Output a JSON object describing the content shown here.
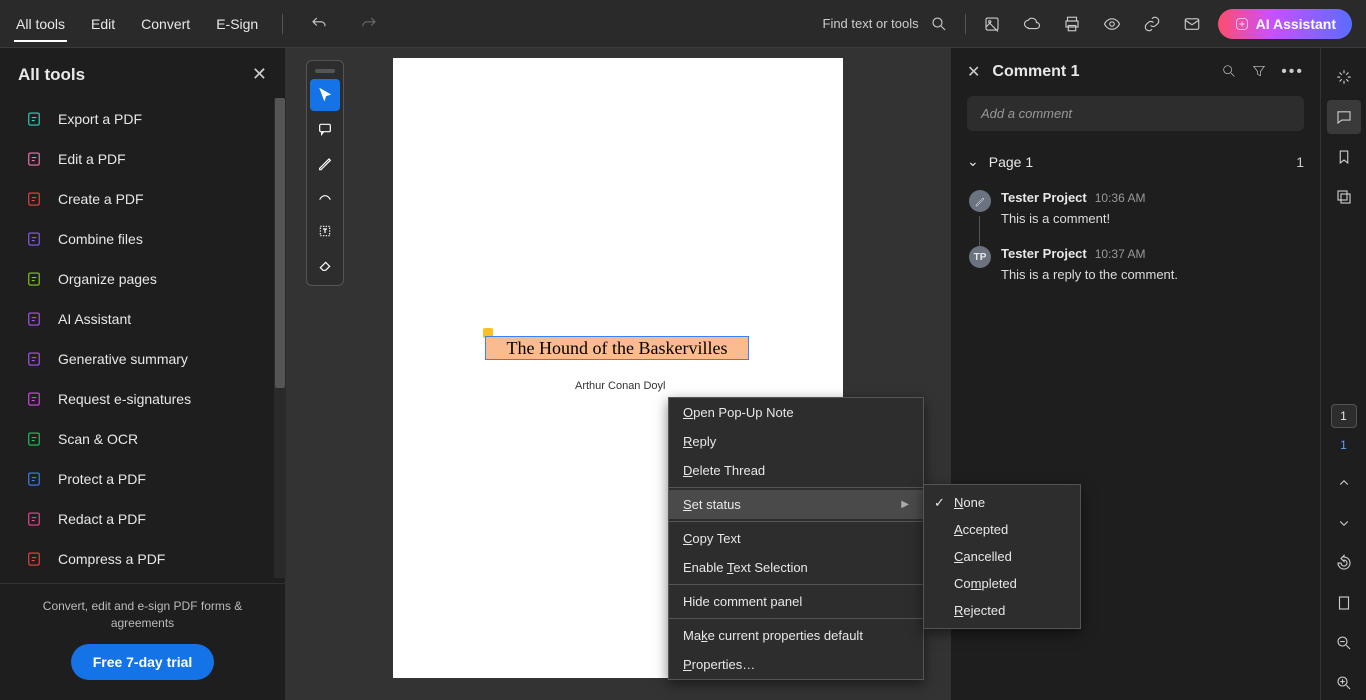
{
  "topbar": {
    "menu": [
      "All tools",
      "Edit",
      "Convert",
      "E-Sign"
    ],
    "search_label": "Find text or tools",
    "ai_label": "AI Assistant"
  },
  "left_panel": {
    "title": "All tools",
    "tools": [
      {
        "label": "Export a PDF",
        "color": "#2dd4bf"
      },
      {
        "label": "Edit a PDF",
        "color": "#f472b6"
      },
      {
        "label": "Create a PDF",
        "color": "#ef4444"
      },
      {
        "label": "Combine files",
        "color": "#8b5cf6"
      },
      {
        "label": "Organize pages",
        "color": "#84cc16"
      },
      {
        "label": "AI Assistant",
        "color": "#a855f7"
      },
      {
        "label": "Generative summary",
        "color": "#a855f7"
      },
      {
        "label": "Request e-signatures",
        "color": "#d946ef"
      },
      {
        "label": "Scan & OCR",
        "color": "#22c55e"
      },
      {
        "label": "Protect a PDF",
        "color": "#3b82f6"
      },
      {
        "label": "Redact a PDF",
        "color": "#ec4899"
      },
      {
        "label": "Compress a PDF",
        "color": "#ef4444"
      }
    ],
    "footer_text": "Convert, edit and e-sign PDF forms & agreements",
    "trial_label": "Free 7-day trial"
  },
  "document": {
    "highlight_text": "The Hound of the Baskervilles",
    "author": "Arthur Conan Doyl"
  },
  "comments": {
    "title": "Comment 1",
    "placeholder": "Add a comment",
    "page_label": "Page 1",
    "page_count": "1",
    "items": [
      {
        "author": "Tester Project",
        "time": "10:36 AM",
        "text": "This is a comment!",
        "avatar": "pencil"
      },
      {
        "author": "Tester Project",
        "time": "10:37 AM",
        "text": "This is a reply to the comment.",
        "avatar": "TP"
      }
    ]
  },
  "context_menu": {
    "items": [
      {
        "label": "Open Pop-Up Note",
        "underline": 0
      },
      {
        "label": "Reply",
        "underline": 0
      },
      {
        "label": "Delete Thread",
        "underline": 0
      },
      {
        "sep": true
      },
      {
        "label": "Set status",
        "underline": 0,
        "submenu": true,
        "hover": true
      },
      {
        "sep": true
      },
      {
        "label": "Copy Text",
        "underline": 0
      },
      {
        "label": "Enable Text Selection",
        "underline": 7
      },
      {
        "sep": true
      },
      {
        "label": "Hide comment panel"
      },
      {
        "sep": true
      },
      {
        "label": "Make current properties default",
        "underline": 2
      },
      {
        "label": "Properties…",
        "underline": 0
      }
    ],
    "submenu": [
      {
        "label": "None",
        "underline": 0,
        "checked": true
      },
      {
        "label": "Accepted",
        "underline": 0
      },
      {
        "label": "Cancelled",
        "underline": 0
      },
      {
        "label": "Completed",
        "underline": 2
      },
      {
        "label": "Rejected",
        "underline": 0
      }
    ]
  },
  "right_rail": {
    "page_current": "1",
    "page_blue": "1"
  }
}
